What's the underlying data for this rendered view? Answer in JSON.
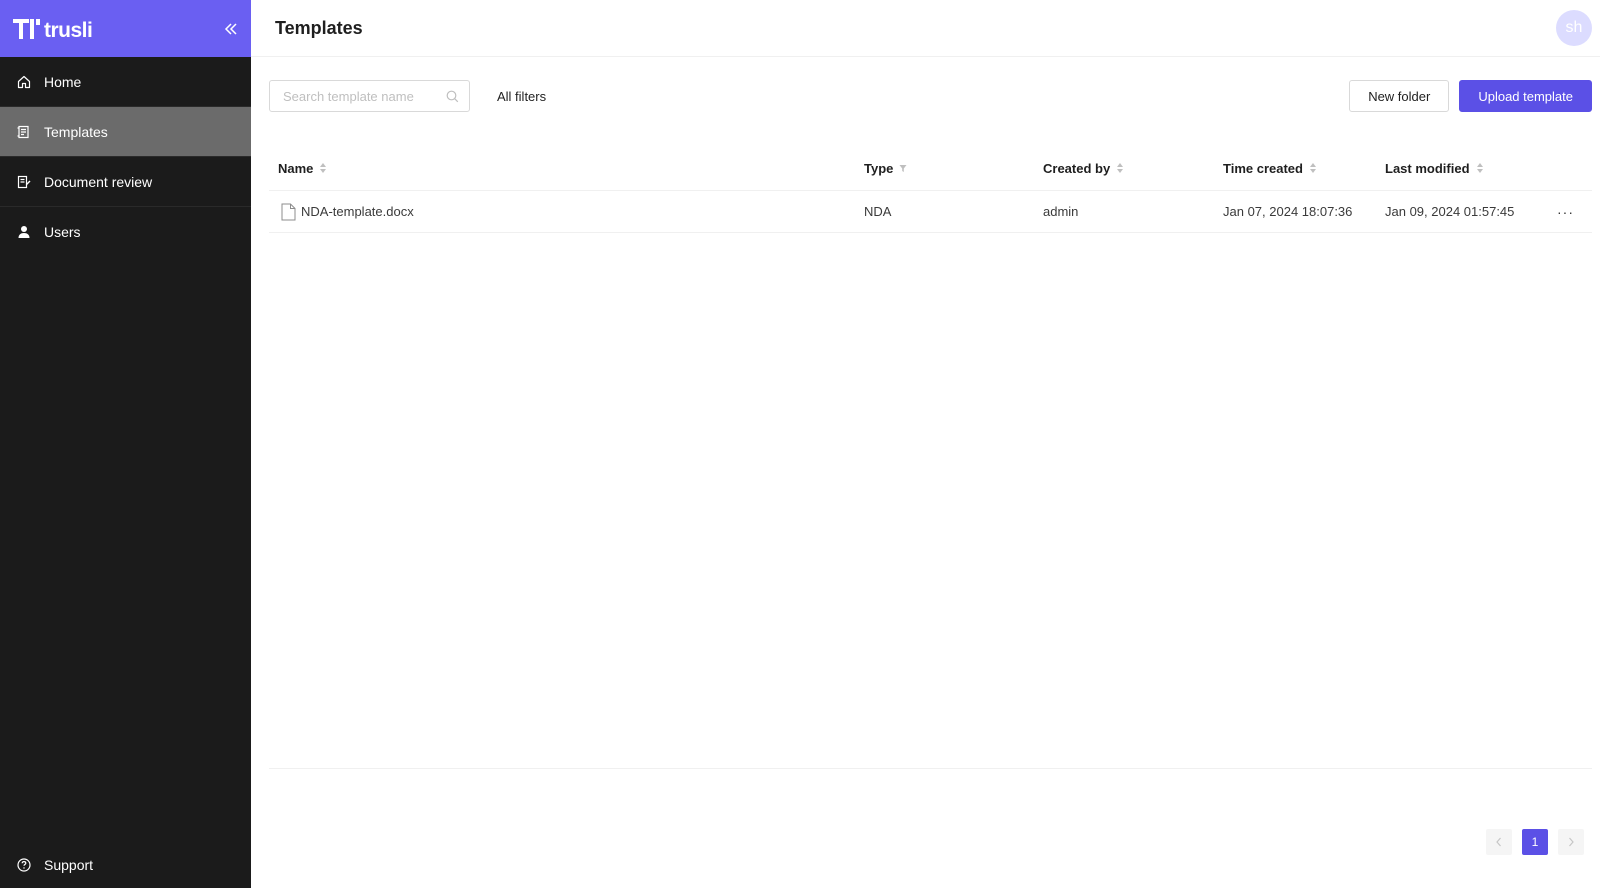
{
  "brand": {
    "logo_text": "trusli"
  },
  "sidebar": {
    "items": [
      {
        "label": "Home",
        "icon": "home-icon",
        "active": false
      },
      {
        "label": "Templates",
        "icon": "templates-icon",
        "active": true
      },
      {
        "label": "Document review",
        "icon": "document-review-icon",
        "active": false
      },
      {
        "label": "Users",
        "icon": "user-icon",
        "active": false
      }
    ],
    "support_label": "Support"
  },
  "header": {
    "title": "Templates",
    "avatar_initials": "sh"
  },
  "toolbar": {
    "search_placeholder": "Search template name",
    "filters_label": "All filters",
    "new_folder_label": "New folder",
    "upload_label": "Upload template"
  },
  "table": {
    "columns": [
      "Name",
      "Type",
      "Created by",
      "Time created",
      "Last modified"
    ],
    "rows": [
      {
        "name": "NDA-template.docx",
        "type": "NDA",
        "created_by": "admin",
        "time_created": "Jan 07, 2024 18:07:36",
        "last_modified": "Jan 09, 2024 01:57:45"
      }
    ]
  },
  "pagination": {
    "current_page": "1"
  },
  "colors": {
    "accent": "#5b50e6",
    "brand": "#6a5ff2",
    "sidebar_bg": "#1b1b1b",
    "active_item": "#6b6b6b"
  }
}
